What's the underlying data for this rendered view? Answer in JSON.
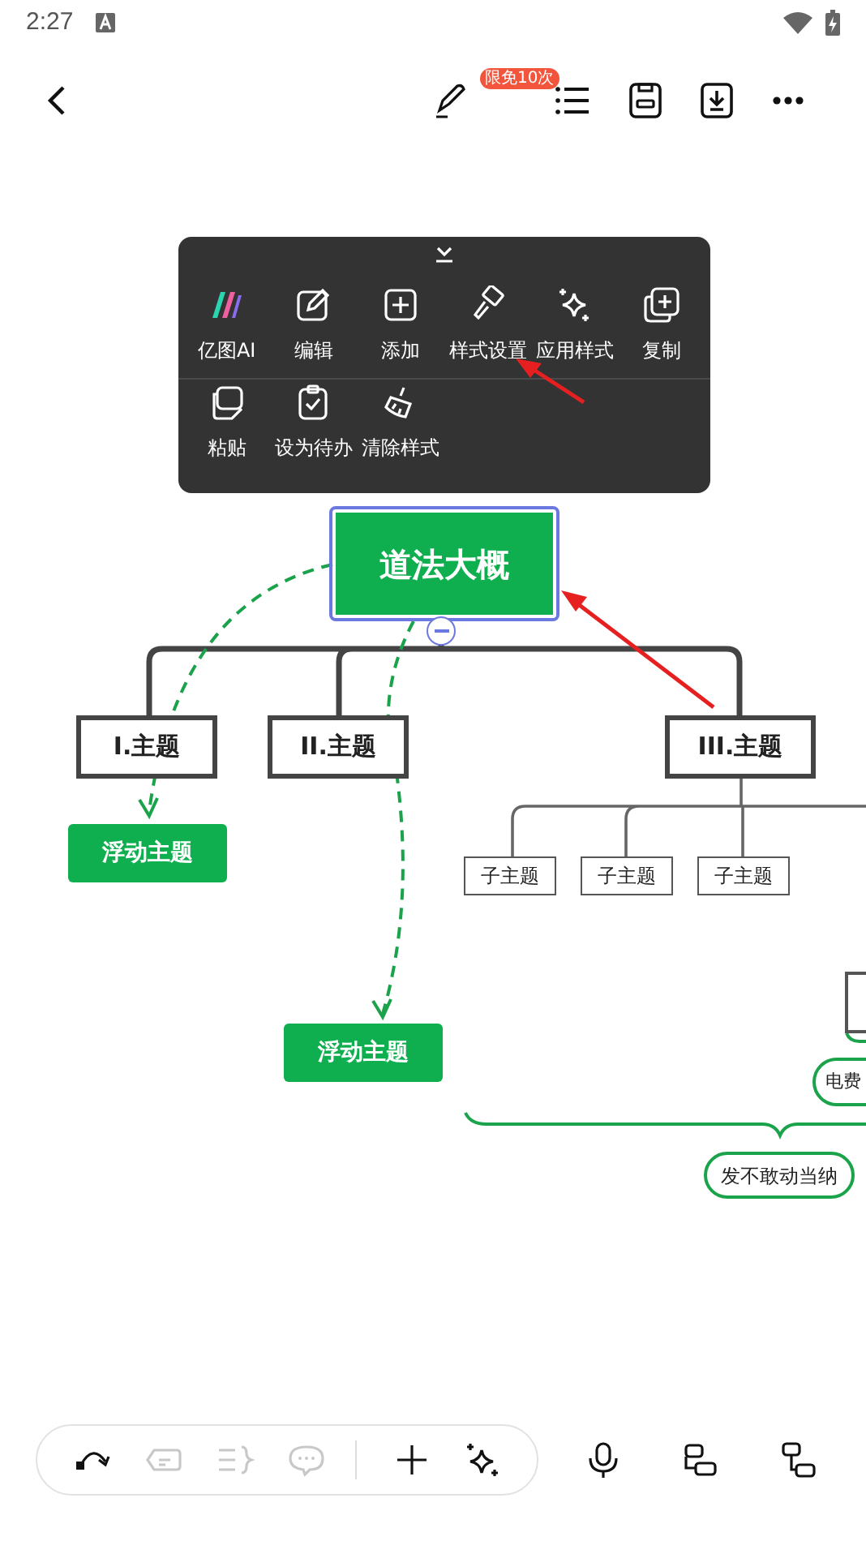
{
  "status_bar": {
    "time": "2:27"
  },
  "header": {
    "badge": "限免10次"
  },
  "context_menu": {
    "items": [
      {
        "kind": "ai",
        "label": "亿图AI"
      },
      {
        "kind": "edit",
        "label": "编辑"
      },
      {
        "kind": "add",
        "label": "添加"
      },
      {
        "kind": "style",
        "label": "样式设置"
      },
      {
        "kind": "apply",
        "label": "应用样式"
      },
      {
        "kind": "copy",
        "label": "复制"
      },
      {
        "kind": "paste",
        "label": "粘贴"
      },
      {
        "kind": "todo",
        "label": "设为待办"
      },
      {
        "kind": "clear",
        "label": "清除样式"
      }
    ]
  },
  "mind_map": {
    "central_topic": {
      "label": "道法大概",
      "selected": true
    },
    "main_topics": [
      {
        "label": "I.主题"
      },
      {
        "label": "II.主题"
      },
      {
        "label": "III.主题"
      }
    ],
    "subtopics": [
      {
        "label": "子主题"
      },
      {
        "label": "子主题"
      },
      {
        "label": "子主题"
      }
    ],
    "floating_topics": [
      {
        "label": "浮动主题"
      },
      {
        "label": "浮动主题"
      }
    ],
    "side_topic": {
      "label": "电费"
    },
    "summary": {
      "label": "发不敢动当纳"
    }
  },
  "bottom_toolbar": {
    "tools": [
      {
        "kind": "relation",
        "disabled": false
      },
      {
        "kind": "label",
        "disabled": true
      },
      {
        "kind": "summary",
        "disabled": true
      },
      {
        "kind": "comment",
        "disabled": true
      },
      {
        "kind": "plus",
        "disabled": false
      },
      {
        "kind": "sparkle",
        "disabled": false
      }
    ],
    "extra": [
      {
        "kind": "mic"
      },
      {
        "kind": "layout"
      },
      {
        "kind": "structure"
      }
    ]
  }
}
